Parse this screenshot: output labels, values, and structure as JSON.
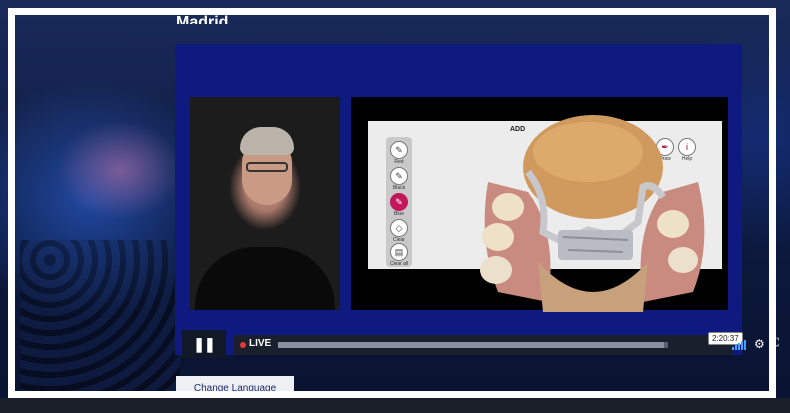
{
  "event": {
    "title": "Madrid"
  },
  "player": {
    "pause_symbol": "❚❚",
    "live_label": "LIVE",
    "time_tooltip": "2:20:37",
    "progress": 0.99,
    "settings_symbol": "⚙",
    "fullscreen_symbol": "⛶"
  },
  "app": {
    "add_label": "ADD",
    "tools": [
      {
        "icon": "brush-icon",
        "symbol": "✎",
        "label": "Red",
        "active": false
      },
      {
        "icon": "brush-icon",
        "symbol": "✎",
        "label": "Black",
        "active": false
      },
      {
        "icon": "brush-icon",
        "symbol": "✎",
        "label": "Blue",
        "active": true
      },
      {
        "icon": "eraser-icon",
        "symbol": "◇",
        "label": "Clear",
        "active": false
      },
      {
        "icon": "trash-icon",
        "symbol": "▤",
        "label": "Clear all",
        "active": false
      }
    ],
    "top_icons": [
      {
        "icon": "pen-icon",
        "symbol": "✒",
        "label": "Draw"
      },
      {
        "icon": "info-icon",
        "symbol": "i",
        "label": "Help"
      }
    ]
  },
  "language": {
    "button_label": "Change Language"
  },
  "colors": {
    "panel": "#0f1a80",
    "live": "#e53935",
    "signal": "#3fa3ff",
    "frame": "#ffffff"
  }
}
